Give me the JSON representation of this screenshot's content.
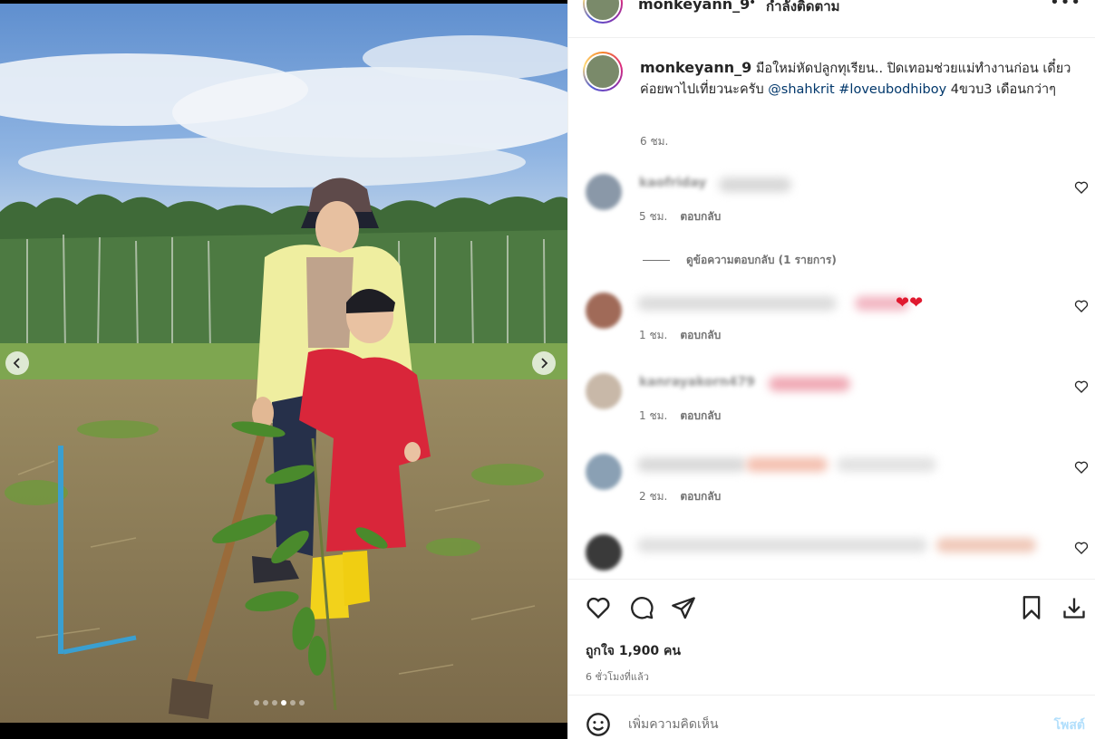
{
  "post": {
    "username": "monkeyann_9",
    "separator": "•",
    "follow_label": "กำลังติดตาม",
    "more_label": "•••"
  },
  "caption": {
    "username": "monkeyann_9",
    "text_part1": "มือใหม่หัดปลูกทุเรียน.. ปิดเทอมช่วยแม่ทำงานก่อน เดี๋ยวค่อยพาไปเที่ยวนะครับ",
    "mention": "@shahkrit",
    "hashtag": "#loveubodhiboy",
    "text_part2": "4ขวบ3 เดือนกว่าๆ",
    "time": "6 ชม."
  },
  "comments": [
    {
      "username": "kaofriday",
      "text": "น่ารักมาก",
      "time": "5 ชม.",
      "reply_label": "ตอบกลับ"
    },
    {
      "username": "",
      "text": "",
      "hearts": "❤❤",
      "time": "1 ชม.",
      "reply_label": "ตอบกลับ"
    },
    {
      "username": "kanrayakorn479",
      "text": "",
      "time": "1 ชม.",
      "reply_label": "ตอบกลับ"
    },
    {
      "username": "",
      "text": "",
      "time": "2 ชม.",
      "reply_label": "ตอบกลับ"
    },
    {
      "username": "",
      "text": ""
    }
  ],
  "view_replies_label": "ดูข้อความตอบกลับ (1 รายการ)",
  "likes_text": "ถูกใจ 1,900 คน",
  "post_time": "6 ชั่วโมงที่แล้ว",
  "add_comment": {
    "placeholder": "เพิ่มความคิดเห็น",
    "post_label": "โพสต์"
  },
  "carousel": {
    "slide_count": 6,
    "active_index": 3
  },
  "colors": {
    "link": "#00376b",
    "heart_red": "#e0192f",
    "post_disabled": "#b2dffc",
    "muted": "#737373"
  },
  "icons": [
    "more-icon",
    "heart-icon",
    "comment-icon",
    "share-icon",
    "bookmark-icon",
    "download-icon",
    "emoji-icon",
    "chevron-left-icon",
    "chevron-right-icon"
  ]
}
